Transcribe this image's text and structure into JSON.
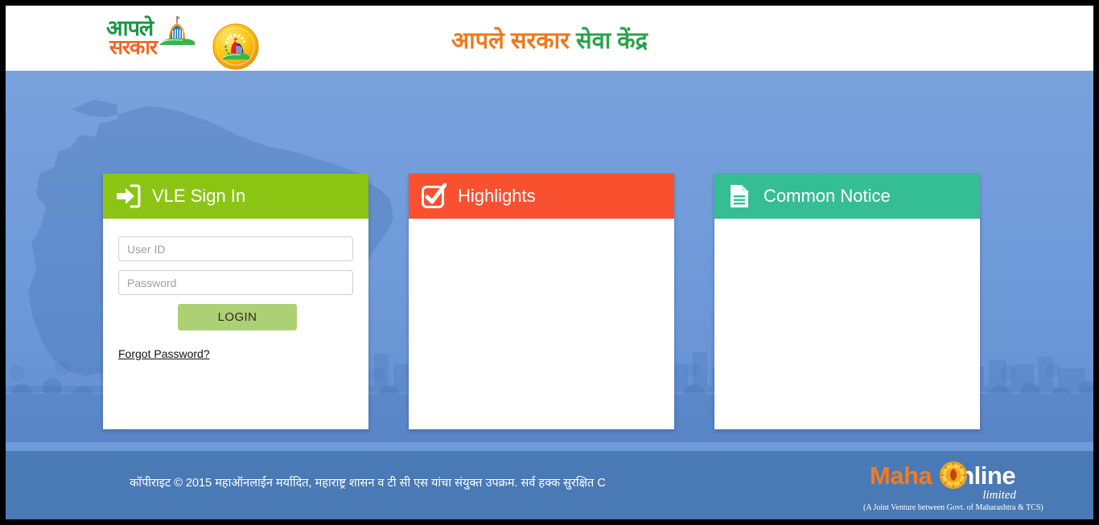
{
  "header": {
    "logo": {
      "name": "aaple-sarkar-logo",
      "line1": "आपले",
      "line2": "सरकार",
      "line1_color": "#1a9641",
      "line2_color": "#f26522"
    },
    "emblem_name": "maharashtra-emblem-badge",
    "title_part1": "आपले सरकार",
    "title_part2": "सेवा केंद्र",
    "title_part1_color": "#f07818",
    "title_part2_color": "#2aa24a"
  },
  "panels": {
    "signin": {
      "title": "VLE Sign In",
      "icon": "sign-in-arrow-icon",
      "header_color": "#8cc413",
      "userid_placeholder": "User ID",
      "userid_value": "",
      "password_placeholder": "Password",
      "password_value": "",
      "login_label": "LOGIN",
      "login_color": "#aed075",
      "forgot_label": "Forgot Password?"
    },
    "highlights": {
      "title": "Highlights",
      "icon": "checkbox-checked-icon",
      "header_color": "#f9512f",
      "items": []
    },
    "notice": {
      "title": "Common Notice",
      "icon": "document-lines-icon",
      "header_color": "#35bd93",
      "items": []
    }
  },
  "footer": {
    "copyright": "कॉपीराइट © 2015 महाऑनलाईन मर्यादित, महाराष्ट्र शासन व टी सी एस यांचा संयुक्त उपक्रम. सर्व हक्क सुरक्षित C",
    "background_color": "#4a7ab5",
    "logo": {
      "name": "mahaonline-logo",
      "word_part1": "Maha",
      "word_part2": "nline",
      "medallion": "golden-medallion-icon",
      "limited": "limited",
      "tagline": "(A Joint Venture between Govt. of Maharashtra & TCS)"
    }
  }
}
